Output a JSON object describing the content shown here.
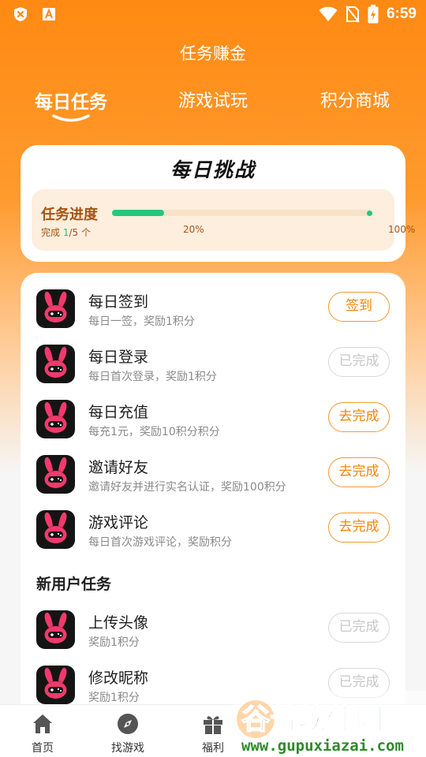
{
  "status_bar": {
    "time": "6:59",
    "icons": [
      "close-circle-icon",
      "text-a-icon",
      "wifi-icon",
      "no-sim-icon",
      "battery-charging-icon"
    ]
  },
  "header": {
    "title": "任务赚金",
    "tabs": [
      {
        "label": "每日任务",
        "active": true
      },
      {
        "label": "游戏试玩",
        "active": false
      },
      {
        "label": "积分商城",
        "active": false
      }
    ]
  },
  "challenge": {
    "title": "每日挑战",
    "progress_label": "任务进度",
    "count_prefix": "完成 ",
    "count_done": "1",
    "count_total": "/5 个",
    "progress_percent": 20,
    "tick_start": "20%",
    "tick_end": "100%"
  },
  "daily_tasks": [
    {
      "name": "每日签到",
      "desc": "每日一签，奖励1积分",
      "button": "签到",
      "completed": false
    },
    {
      "name": "每日登录",
      "desc": "每日首次登录，奖励1积分",
      "button": "已完成",
      "completed": true
    },
    {
      "name": "每日充值",
      "desc": "每充1元，奖励10积分积分",
      "button": "去完成",
      "completed": false
    },
    {
      "name": "邀请好友",
      "desc": "邀请好友并进行实名认证，奖励100积分",
      "button": "去完成",
      "completed": false
    },
    {
      "name": "游戏评论",
      "desc": "每日首次游戏评论，奖励积分",
      "button": "去完成",
      "completed": false
    }
  ],
  "new_user_section": {
    "title": "新用户任务",
    "tasks": [
      {
        "name": "上传头像",
        "desc": "奖励1积分",
        "button": "已完成",
        "completed": true
      },
      {
        "name": "修改昵称",
        "desc": "奖励1积分",
        "button": "已完成",
        "completed": true
      }
    ]
  },
  "bottom_nav": [
    {
      "label": "首页",
      "icon": "home-icon"
    },
    {
      "label": "找游戏",
      "icon": "compass-icon"
    },
    {
      "label": "福利",
      "icon": "gift-icon"
    }
  ],
  "watermark": {
    "title": "谷普软件园",
    "url": "www.gupuxiazai.com"
  },
  "colors": {
    "brand_orange": "#ff8a12",
    "progress_green": "#27c67f",
    "button_orange": "#f0860e",
    "muted_gray": "#c8c8c8"
  }
}
